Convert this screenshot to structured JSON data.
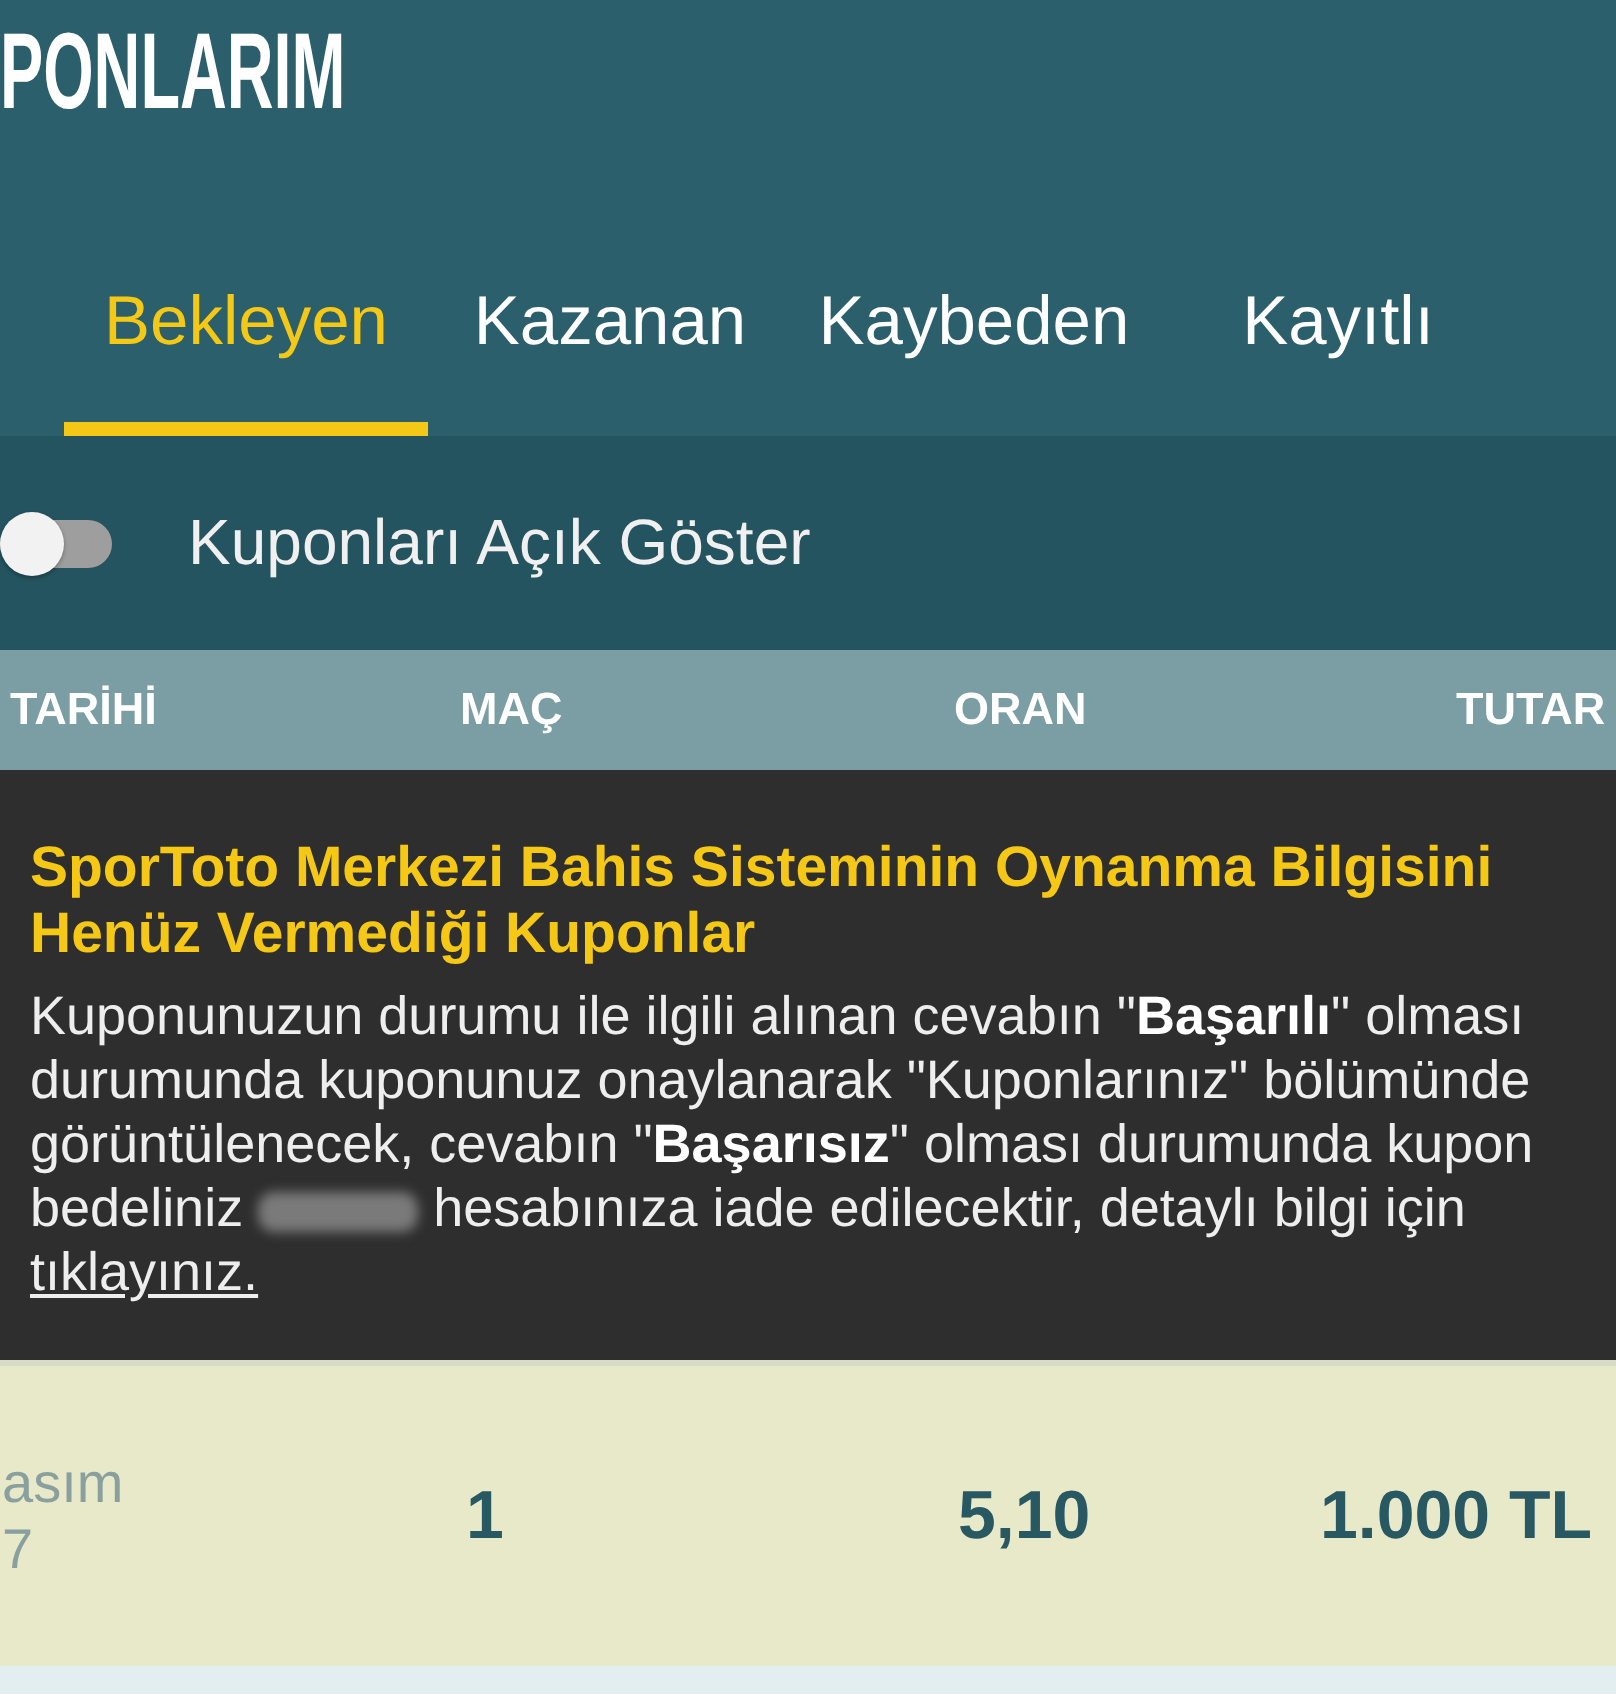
{
  "screen": {
    "title": "PONLARIM"
  },
  "tabs": [
    {
      "label": "Bekleyen",
      "selected": true
    },
    {
      "label": "Kazanan",
      "selected": false
    },
    {
      "label": "Kaybeden",
      "selected": false
    },
    {
      "label": "Kayıtlı",
      "selected": false
    }
  ],
  "toggle": {
    "label": "Kuponları Açık Göster",
    "on": false
  },
  "table": {
    "columns": [
      "TARİHİ",
      "MAÇ",
      "ORAN",
      "TUTAR"
    ],
    "notice": {
      "title": "SporToto Merkezi Bahis Sisteminin Oynanma Bilgisini Henüz Vermediği Kuponlar",
      "body": [
        {
          "kind": "text",
          "text": "Kuponunuzun durumu ile ilgili alınan cevabın \"**Başarılı**\" olması durumunda kuponunuz onaylanarak \"Kuponlarınız\" bölümünde görüntülenecek, cevabın \"**Başarısız**\" olması durumunda kupon bedeliniz"
        },
        {
          "kind": "redacted"
        },
        {
          "kind": "text",
          "text": "hesabınıza iade edilecektir, detaylı bilgi için"
        },
        {
          "kind": "link",
          "text": "tıklayınız."
        }
      ]
    },
    "rows": [
      {
        "date": "asım\n7",
        "match": "1",
        "odds": "5,10",
        "amount": "1.000 TL"
      }
    ]
  }
}
